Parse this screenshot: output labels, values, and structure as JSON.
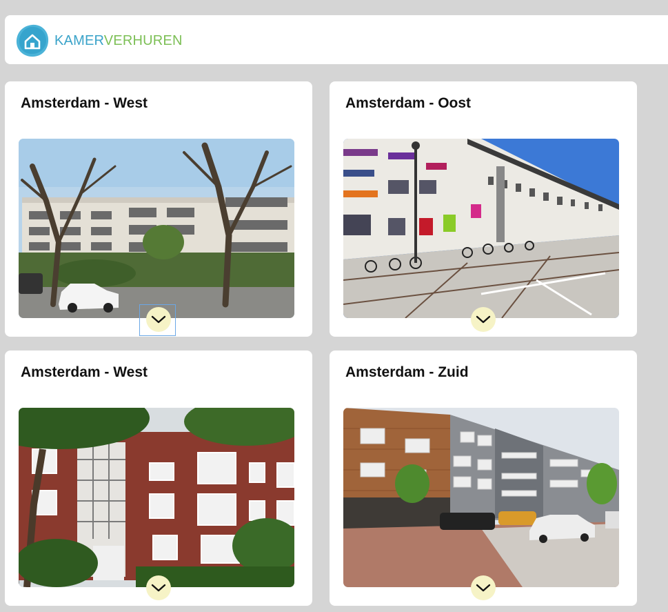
{
  "header": {
    "logo_part1": "KAMER",
    "logo_part2": "VERHUREN",
    "logo_icon": "house-icon"
  },
  "cards": [
    {
      "title": "Amsterdam - West",
      "expand_icon": "chevron-down-icon"
    },
    {
      "title": "Amsterdam - Oost",
      "expand_icon": "chevron-down-icon"
    },
    {
      "title": "Amsterdam - West",
      "expand_icon": "chevron-down-icon"
    },
    {
      "title": "Amsterdam - Zuid",
      "expand_icon": "chevron-down-icon"
    }
  ],
  "colors": {
    "page_bg": "#d5d5d5",
    "card_bg": "#ffffff",
    "logo_blue": "#3aa3c9",
    "logo_green": "#7cbf55",
    "expand_button": "#f6f3c6"
  }
}
